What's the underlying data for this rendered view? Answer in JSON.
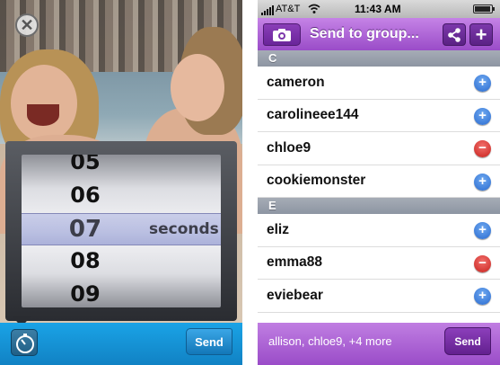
{
  "left_screen": {
    "picker": {
      "rows": [
        "05",
        "06",
        "07",
        "08",
        "09"
      ],
      "selected_value": "07",
      "selected_unit": "seconds"
    },
    "send_label": "Send"
  },
  "right_screen": {
    "status_bar": {
      "carrier": "AT&T",
      "time": "11:43 AM"
    },
    "navbar": {
      "title": "Send to group..."
    },
    "sections": [
      {
        "header": "C",
        "rows": [
          {
            "name": "cameron",
            "action": "add"
          },
          {
            "name": "carolineee144",
            "action": "add"
          },
          {
            "name": "chloe9",
            "action": "remove"
          },
          {
            "name": "cookiemonster",
            "action": "add"
          }
        ]
      },
      {
        "header": "E",
        "rows": [
          {
            "name": "eliz",
            "action": "add"
          },
          {
            "name": "emma88",
            "action": "remove"
          },
          {
            "name": "eviebear",
            "action": "add"
          }
        ]
      }
    ],
    "recipients": "allison, chloe9, +4 more",
    "send_label": "Send"
  },
  "colors": {
    "accent_blue": "#1aa3e6",
    "accent_purple": "#9a4cc8",
    "add_blue": "#2a6bd0",
    "remove_red": "#c8211d"
  }
}
